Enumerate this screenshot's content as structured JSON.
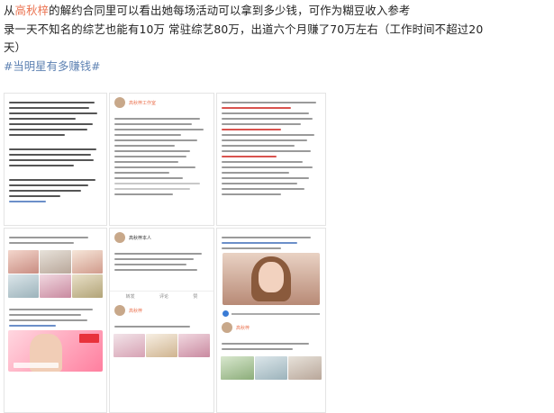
{
  "post": {
    "line1_prefix": "从",
    "mention": "高秋梓",
    "line1_suffix": "的解约合同里可以看出她每场活动可以拿到多少钱，可作为糊豆收入参考",
    "line2": "录一天不知名的综艺也能有10万 常驻综艺80万，出道六个月赚了70万左右（工作时间不超过20",
    "line3": "天）",
    "hashtag": "#当明星有多赚钱#"
  },
  "screenshots": {
    "s2_name": "高秋梓工作室",
    "s3_name": "高秋梓本人",
    "s4_name": "高秋梓",
    "s5_name": "高秋梓本人",
    "s6_name": "高秋梓",
    "bottom_bar": [
      "转发",
      "评论",
      "赞"
    ]
  }
}
